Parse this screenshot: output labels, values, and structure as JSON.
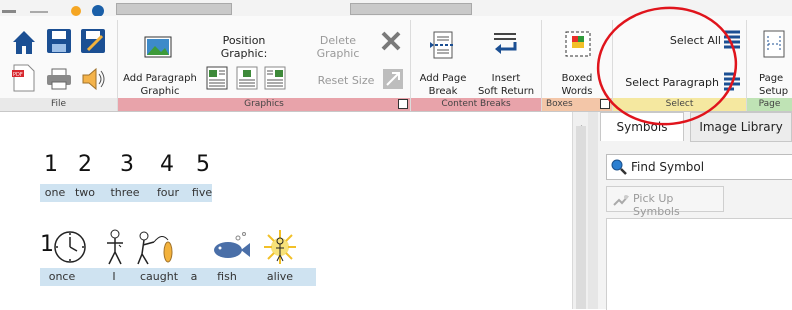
{
  "ribbon": {
    "file_group": {
      "footer": "File"
    },
    "graphics_group": {
      "footer": "Graphics",
      "add_paragraph_graphic_line1": "Add Paragraph",
      "add_paragraph_graphic_line2": "Graphic",
      "position_graphic_label": "Position Graphic:",
      "delete_graphic_label": "Delete Graphic",
      "reset_size_label": "Reset Size"
    },
    "content_breaks_group": {
      "footer": "Content Breaks",
      "add_page_break_line1": "Add Page",
      "add_page_break_line2": "Break",
      "insert_soft_return_line1": "Insert",
      "insert_soft_return_line2": "Soft Return"
    },
    "boxes_group": {
      "footer": "Boxes",
      "boxed_words_line1": "Boxed",
      "boxed_words_line2": "Words"
    },
    "select_group": {
      "footer": "Select",
      "select_all_label": "Select All",
      "select_paragraph_label": "Select Paragraph"
    },
    "page_group": {
      "footer": "Page",
      "page_setup_line1": "Page",
      "page_setup_line2": "Setup"
    }
  },
  "document": {
    "numbers_line": {
      "numbers": [
        "1",
        "2",
        "3",
        "4",
        "5"
      ],
      "words": [
        "one",
        "two",
        "three",
        "four",
        "five"
      ]
    },
    "sentence_line": {
      "lead_number": "1",
      "words": [
        "once",
        "I",
        "caught",
        "a",
        "fish",
        "alive"
      ]
    }
  },
  "side_panel": {
    "tabs": [
      "Symbols",
      "Image Library"
    ],
    "find_symbol_label": "Find Symbol",
    "pick_up_symbols_label": "Pick Up Symbols"
  },
  "colors": {
    "graphics_footer": "#e8a3aa",
    "content_breaks_footer": "#e8a3aa",
    "boxes_footer": "#f3c6a8",
    "select_footer": "#f5e8a0",
    "page_footer": "#bfe3b5",
    "highlight_blue": "#cfe3f1",
    "annotation_red": "#e0141c"
  }
}
